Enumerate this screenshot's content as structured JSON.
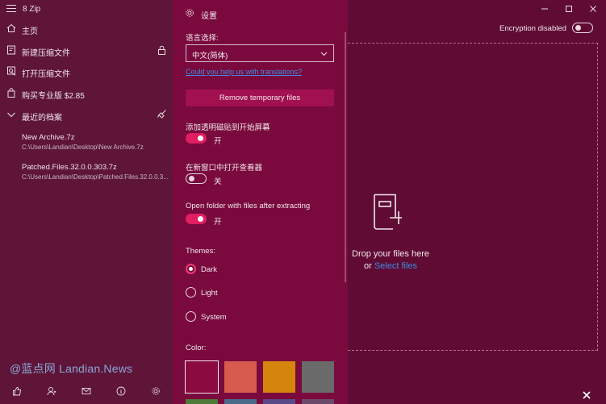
{
  "app": {
    "title": "8 Zip"
  },
  "sidebar": {
    "items": [
      {
        "label": "主页",
        "icon": "home-icon"
      },
      {
        "label": "新建压缩文件",
        "icon": "new-archive-icon"
      },
      {
        "label": "打开压缩文件",
        "icon": "open-archive-icon"
      },
      {
        "label": "购买专业版 $2.85",
        "icon": "shop-icon"
      }
    ],
    "recent_header": "最近的档案",
    "recent": [
      {
        "name": "New Archive.7z",
        "path": "C:\\Users\\Landian\\Desktop\\New Archive.7z"
      },
      {
        "name": "Patched.Files.32.0.0.303.7z",
        "path": "C:\\Users\\Landian\\Desktop\\Patched.Files.32.0.0.3..."
      }
    ],
    "bottom_icons": [
      "thumbs-up-icon",
      "user-icon",
      "mail-icon",
      "info-icon",
      "gear-icon"
    ]
  },
  "watermark": "@蓝点网 Landian.News",
  "settings": {
    "title": "设置",
    "language_label": "语言选择:",
    "language_value": "中文(简体)",
    "translation_link": "Could you help us with translations?",
    "remove_button": "Remove temporary files",
    "pin_label": "添加透明磁贴到开始屏幕",
    "pin_state": "开",
    "pin_on": true,
    "new_window_label": "在新窗口中打开查看器",
    "new_window_state": "关",
    "new_window_on": false,
    "open_folder_label": "Open folder with files after extracting",
    "open_folder_state": "开",
    "open_folder_on": true,
    "themes_label": "Themes:",
    "themes": [
      {
        "label": "Dark",
        "selected": true
      },
      {
        "label": "Light",
        "selected": false
      },
      {
        "label": "System",
        "selected": false
      }
    ],
    "color_label": "Color:",
    "colors": [
      "#8b0a40",
      "#d75a4f",
      "#d4860c",
      "#6a6a6a"
    ],
    "colors_row2": [
      "#4e7a3a",
      "#4a6a8a",
      "#5a4a8a",
      "#6a4a6a"
    ]
  },
  "main": {
    "encryption_label": "Encryption disabled",
    "drop_text": "Drop your files here",
    "or_text": "or",
    "select_files": "Select files"
  },
  "colors": {
    "background": "#5f0b34",
    "sidebar": "#5e1538",
    "settings_panel": "#7a0a3d",
    "accent": "#e21e63",
    "link": "#3c8ce0"
  }
}
